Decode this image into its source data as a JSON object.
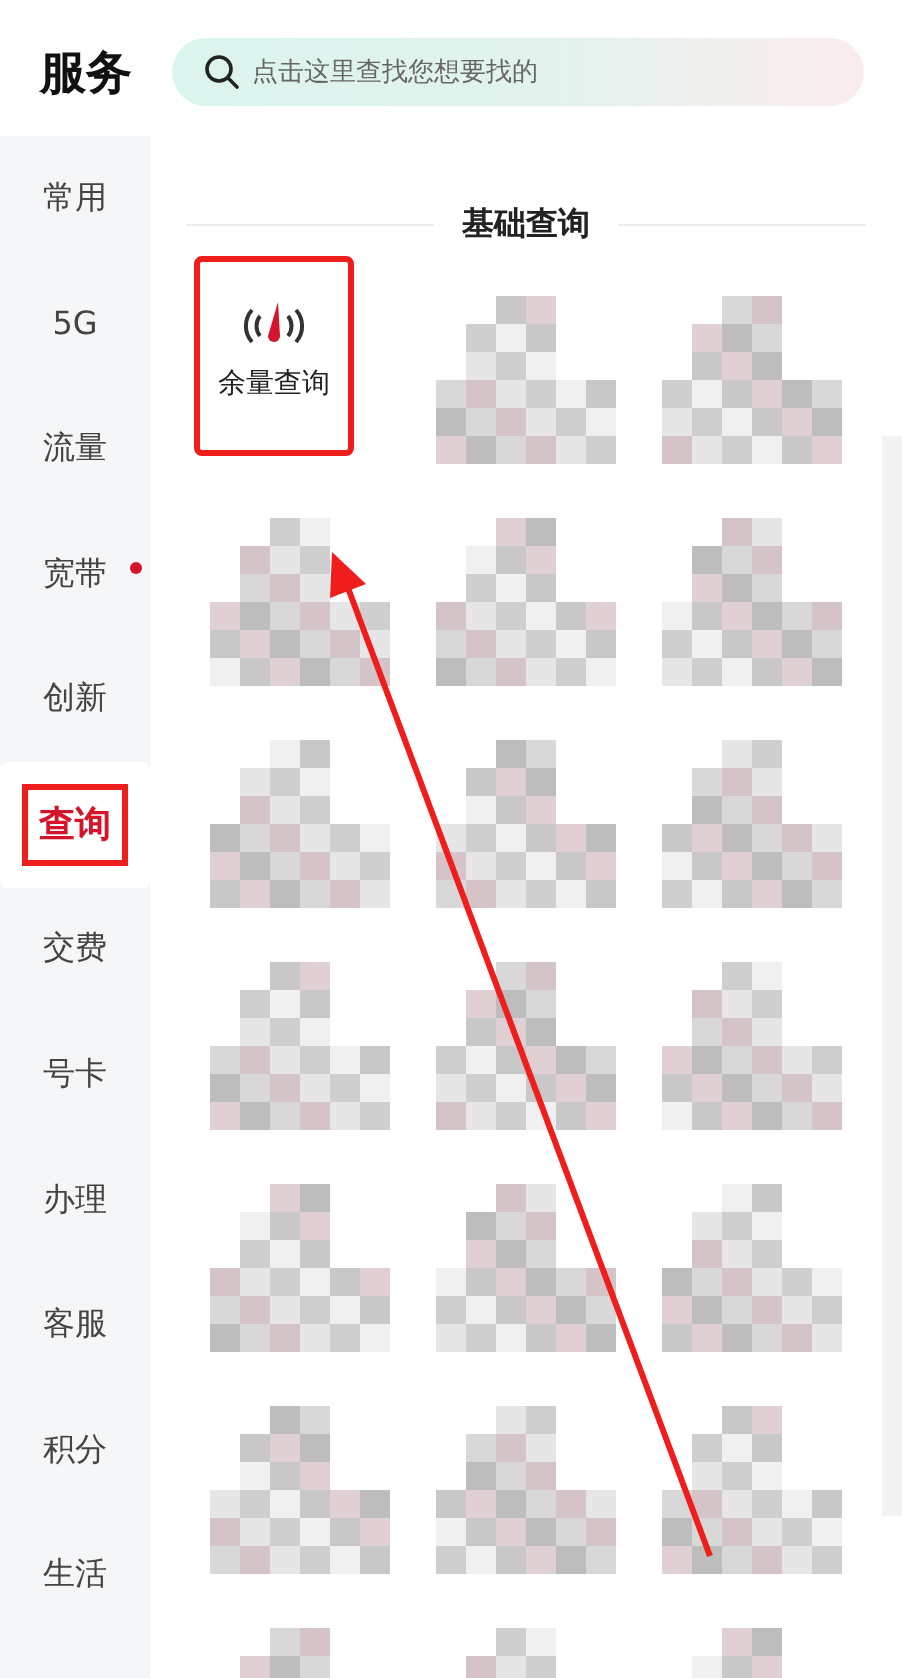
{
  "header": {
    "title": "服务",
    "search": {
      "placeholder": "点击这里查找您想要找的"
    }
  },
  "sidebar": {
    "items": [
      {
        "label": "常用",
        "selected": false,
        "dot": false,
        "highlighted": false
      },
      {
        "label": "5G",
        "selected": false,
        "dot": false,
        "highlighted": false
      },
      {
        "label": "流量",
        "selected": false,
        "dot": false,
        "highlighted": false
      },
      {
        "label": "宽带",
        "selected": false,
        "dot": true,
        "highlighted": false
      },
      {
        "label": "创新",
        "selected": false,
        "dot": false,
        "highlighted": false
      },
      {
        "label": "查询",
        "selected": true,
        "dot": false,
        "highlighted": true
      },
      {
        "label": "交费",
        "selected": false,
        "dot": false,
        "highlighted": false
      },
      {
        "label": "号卡",
        "selected": false,
        "dot": false,
        "highlighted": false
      },
      {
        "label": "办理",
        "selected": false,
        "dot": false,
        "highlighted": false
      },
      {
        "label": "客服",
        "selected": false,
        "dot": false,
        "highlighted": false
      },
      {
        "label": "积分",
        "selected": false,
        "dot": false,
        "highlighted": false
      },
      {
        "label": "生活",
        "selected": false,
        "dot": false,
        "highlighted": false
      }
    ]
  },
  "section": {
    "title": "基础查询",
    "tiles": [
      {
        "kind": "service",
        "label": "余量查询",
        "highlighted": true
      },
      {
        "kind": "obscured"
      },
      {
        "kind": "obscured"
      },
      {
        "kind": "obscured"
      },
      {
        "kind": "obscured"
      },
      {
        "kind": "obscured"
      },
      {
        "kind": "obscured"
      },
      {
        "kind": "obscured"
      },
      {
        "kind": "obscured"
      },
      {
        "kind": "obscured"
      },
      {
        "kind": "obscured"
      },
      {
        "kind": "obscured"
      },
      {
        "kind": "obscured"
      },
      {
        "kind": "obscured"
      },
      {
        "kind": "obscured"
      },
      {
        "kind": "obscured"
      },
      {
        "kind": "obscured"
      },
      {
        "kind": "obscured"
      },
      {
        "kind": "obscured"
      },
      {
        "kind": "obscured"
      },
      {
        "kind": "obscured"
      }
    ]
  },
  "annotations": [
    {
      "kind": "arrow"
    }
  ]
}
